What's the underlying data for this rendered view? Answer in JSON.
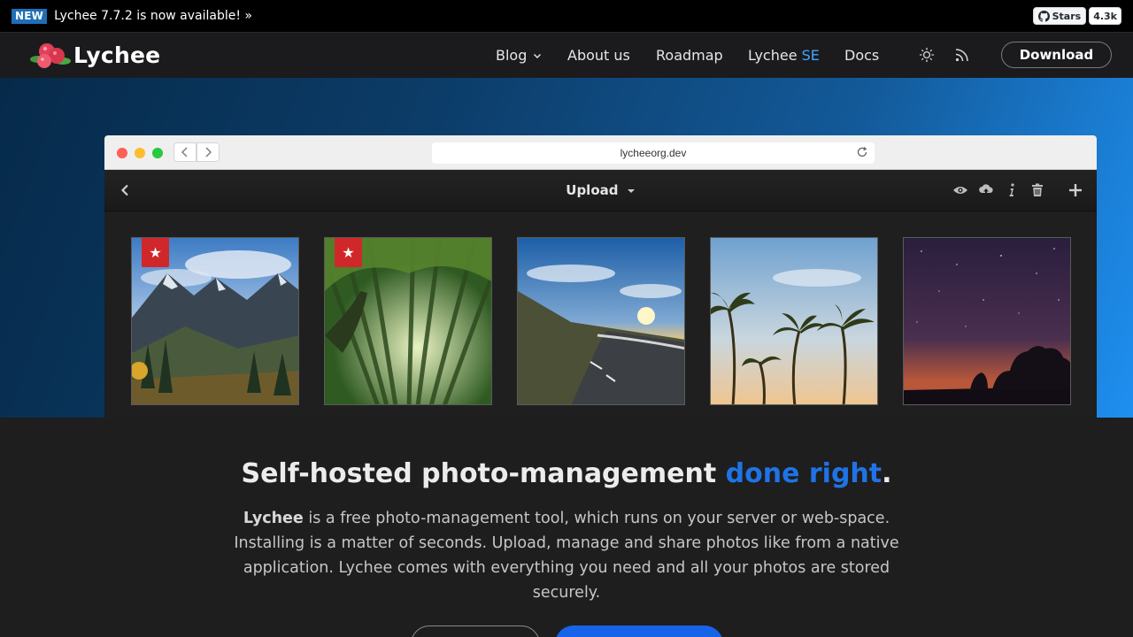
{
  "announcement": {
    "badge": "NEW",
    "text": "Lychee 7.7.2 is now available! »"
  },
  "github": {
    "label": "Stars",
    "count": "4.3k"
  },
  "nav": {
    "logo": "Lychee",
    "blog": "Blog",
    "about": "About us",
    "roadmap": "Roadmap",
    "se_prefix": "Lychee",
    "se_suffix": "SE",
    "docs": "Docs",
    "download": "Download"
  },
  "browser": {
    "url": "lycheeorg.dev",
    "toolbar_title": "Upload"
  },
  "headline": {
    "part1": "Self-hosted photo-management ",
    "highlight": "done right",
    "end": "."
  },
  "description": {
    "brand": "Lychee",
    "text": " is a free photo-management tool, which runs on your server or web-space. Installing is a matter of seconds. Upload, manage and share photos like from a native application. Lychee comes with everything you need and all your photos are stored securely."
  },
  "colors": {
    "accent": "#1f73e6",
    "star_badge": "#d0282a",
    "nav_bg": "#1b1b1d",
    "body_bg": "#1e1e1e"
  }
}
